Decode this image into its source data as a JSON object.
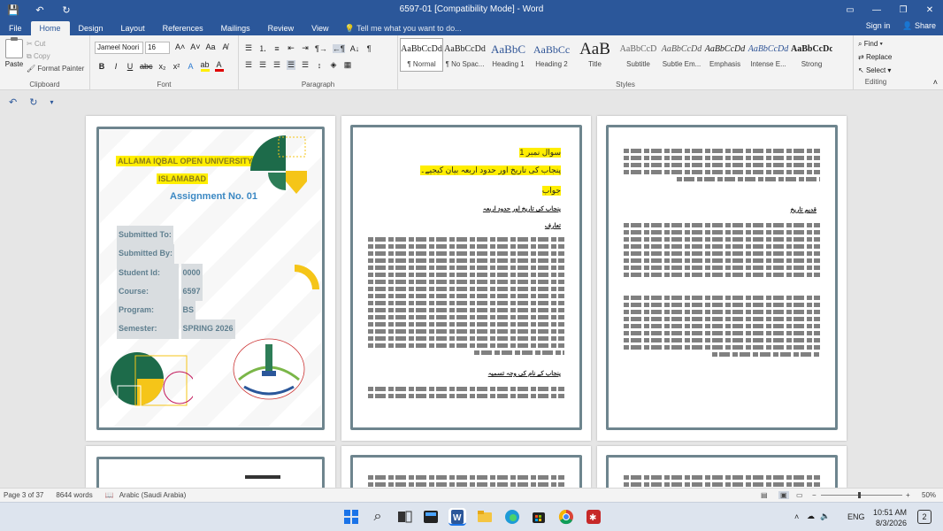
{
  "window": {
    "title": "6597-01 [Compatibility Mode] - Word",
    "sign_in": "Sign in",
    "share": "Share"
  },
  "tabs": [
    "File",
    "Home",
    "Design",
    "Layout",
    "References",
    "Mailings",
    "Review",
    "View"
  ],
  "tell_me": "Tell me what you want to do...",
  "clipboard": {
    "paste": "Paste",
    "cut": "Cut",
    "copy": "Copy",
    "format_painter": "Format Painter",
    "label": "Clipboard"
  },
  "font": {
    "name": "Jameel Noori",
    "size": "16",
    "label": "Font"
  },
  "paragraph": {
    "label": "Paragraph"
  },
  "styles": {
    "label": "Styles",
    "items": [
      {
        "sample": "AaBbCcDd",
        "name": "¶ Normal"
      },
      {
        "sample": "AaBbCcDd",
        "name": "¶ No Spac..."
      },
      {
        "sample": "AaBbC",
        "name": "Heading 1"
      },
      {
        "sample": "AaBbCc",
        "name": "Heading 2"
      },
      {
        "sample": "AaB",
        "name": "Title"
      },
      {
        "sample": "AaBbCcD",
        "name": "Subtitle"
      },
      {
        "sample": "AaBbCcDd",
        "name": "Subtle Em..."
      },
      {
        "sample": "AaBbCcDd",
        "name": "Emphasis"
      },
      {
        "sample": "AaBbCcDd",
        "name": "Intense E..."
      },
      {
        "sample": "AaBbCcDc",
        "name": "Strong"
      }
    ]
  },
  "editing": {
    "find": "Find",
    "replace": "Replace",
    "select": "Select",
    "label": "Editing"
  },
  "cover": {
    "university": "ALLAMA IQBAL OPEN UNIVERSITY",
    "city": "ISLAMABAD",
    "assignment": "Assignment No. 01",
    "submitted_to": "Submitted To:",
    "submitted_by": "Submitted By:",
    "student_id_label": "Student Id:",
    "student_id": "0000",
    "course_label": "Course:",
    "course": "6597",
    "program_label": "Program:",
    "program": "BS",
    "semester_label": "Semester:",
    "semester": "SPRING 2026"
  },
  "page2": {
    "q": "سوال نمبر 1",
    "qtext": "پنجاب کی تاریخ اور حدود اربعہ بیان کیجیے۔",
    "answer": "جواب",
    "heading1": "پنجاب کی تاریخ اور حدود اربعہ",
    "heading2": "تعارف",
    "heading3": "پنجاب کے نام کی وجہ تسمیہ"
  },
  "page3": {
    "heading": "قدیم تاریخ"
  },
  "status": {
    "page": "Page 3 of 37",
    "words": "8644 words",
    "language": "Arabic (Saudi Arabia)",
    "zoom": "50%"
  },
  "taskbar": {
    "lang": "ENG",
    "time": "10:51 AM",
    "date": "8/3/2026"
  }
}
